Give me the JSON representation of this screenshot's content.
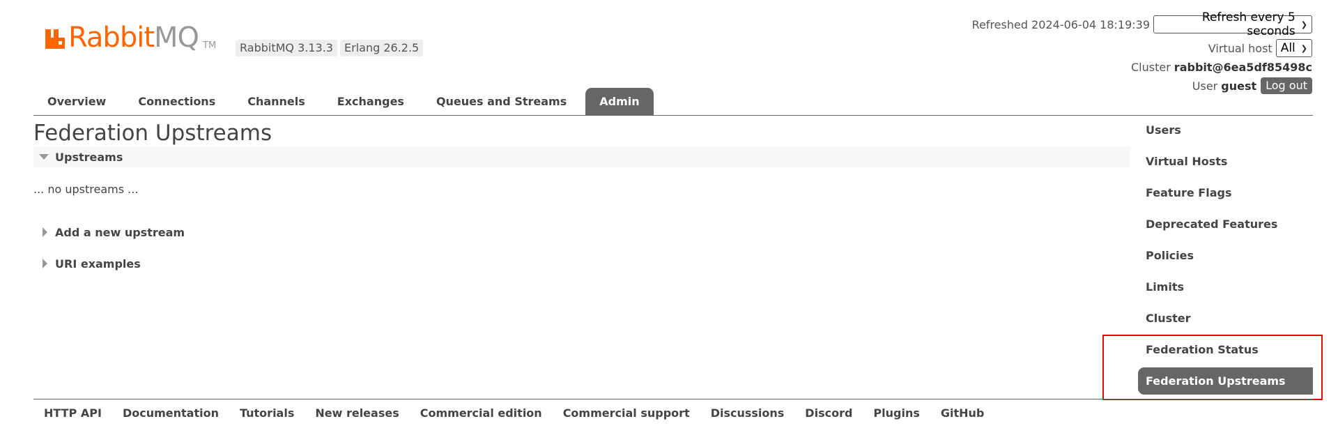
{
  "header": {
    "logo": {
      "rabbit": "Rabbit",
      "mq": "MQ",
      "tm": "TM",
      "color": "#ff6600"
    },
    "versions": {
      "rabbitmq": "RabbitMQ 3.13.3",
      "erlang": "Erlang 26.2.5"
    },
    "refreshed_label": "Refreshed 2024-06-04 18:19:39",
    "refresh_select": "Refresh every 5 seconds",
    "vhost_label": "Virtual host",
    "vhost_select": "All",
    "cluster_label": "Cluster",
    "cluster_name": "rabbit@6ea5df85498c",
    "user_label": "User",
    "user_name": "guest",
    "logout": "Log out"
  },
  "tabs": [
    {
      "label": "Overview"
    },
    {
      "label": "Connections"
    },
    {
      "label": "Channels"
    },
    {
      "label": "Exchanges"
    },
    {
      "label": "Queues and Streams"
    },
    {
      "label": "Admin",
      "active": true
    }
  ],
  "main": {
    "title": "Federation Upstreams",
    "upstreams_section": "Upstreams",
    "empty_text": "... no upstreams ...",
    "add_upstream": "Add a new upstream",
    "uri_examples": "URI examples"
  },
  "admin_menu": [
    {
      "label": "Users"
    },
    {
      "label": "Virtual Hosts"
    },
    {
      "label": "Feature Flags"
    },
    {
      "label": "Deprecated Features"
    },
    {
      "label": "Policies"
    },
    {
      "label": "Limits"
    },
    {
      "label": "Cluster"
    },
    {
      "label": "Federation Status"
    },
    {
      "label": "Federation Upstreams",
      "active": true
    }
  ],
  "footer": [
    {
      "label": "HTTP API"
    },
    {
      "label": "Documentation"
    },
    {
      "label": "Tutorials"
    },
    {
      "label": "New releases"
    },
    {
      "label": "Commercial edition"
    },
    {
      "label": "Commercial support"
    },
    {
      "label": "Discussions"
    },
    {
      "label": "Discord"
    },
    {
      "label": "Plugins"
    },
    {
      "label": "GitHub"
    }
  ],
  "colors": {
    "accent": "#ff6600",
    "active_tab": "#666666",
    "highlight": "#ee0000"
  }
}
